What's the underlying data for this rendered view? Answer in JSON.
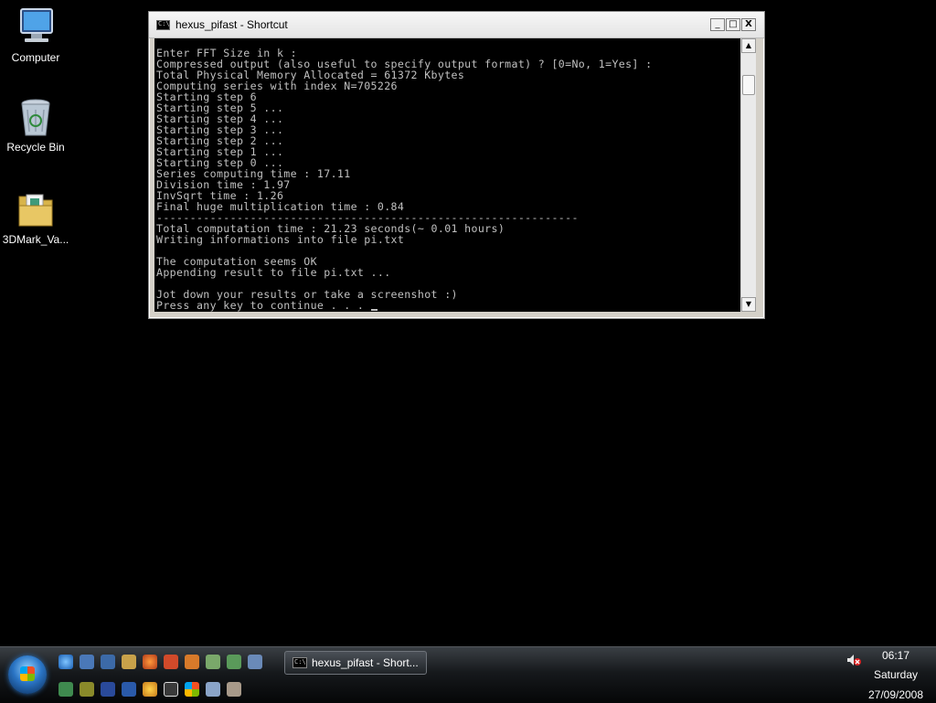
{
  "desktop": {
    "icons": [
      {
        "label": "Computer"
      },
      {
        "label": "Recycle Bin"
      },
      {
        "label": "3DMark_Va..."
      }
    ]
  },
  "window": {
    "title": "hexus_pifast - Shortcut",
    "buttons": {
      "minimize": "_",
      "maximize": "□",
      "close": "X"
    },
    "console_text": "Enter FFT Size in k :\nCompressed output (also useful to specify output format) ? [0=No, 1=Yes] :\nTotal Physical Memory Allocated = 61372 Kbytes\nComputing series with index N=705226\nStarting step 6\nStarting step 5 ...\nStarting step 4 ...\nStarting step 3 ...\nStarting step 2 ...\nStarting step 1 ...\nStarting step 0 ...\nSeries computing time : 17.11\nDivision time : 1.97\nInvSqrt time : 1.26\nFinal huge multiplication time : 0.84\n---------------------------------------------------------------\nTotal computation time : 21.23 seconds(~ 0.01 hours)\nWriting informations into file pi.txt\n\nThe computation seems OK\nAppending result to file pi.txt ...\n\nJot down your results or take a screenshot :)\nPress any key to continue . . . "
  },
  "taskbar": {
    "active_task": "hexus_pifast - Short...",
    "clock": {
      "time": "06:17",
      "day": "Saturday",
      "date": "27/09/2008"
    }
  }
}
